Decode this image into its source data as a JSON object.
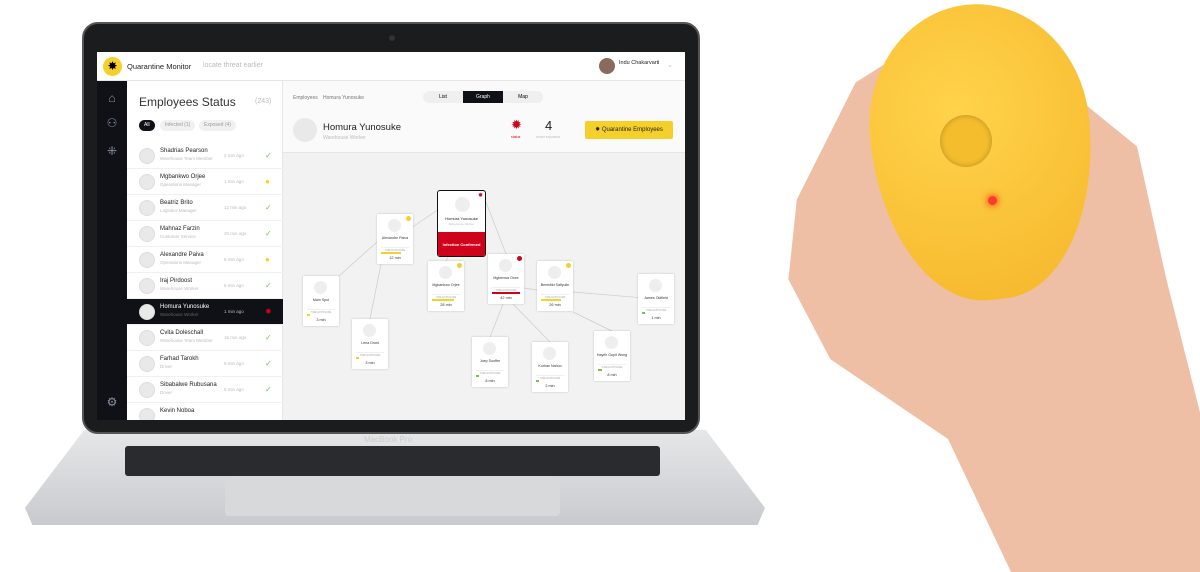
{
  "app": {
    "title": "Quarantine Monitor",
    "tagline": "locate threat earlier",
    "user": "Indu Chakarvarti"
  },
  "list": {
    "title": "Employees Status",
    "count": "(243)",
    "filters": [
      {
        "label": "All"
      },
      {
        "label": "Infected (1)"
      },
      {
        "label": "Exposed (4)"
      }
    ],
    "items": [
      {
        "name": "Shadrias Pearson",
        "role": "Warehouse Team Member",
        "time": "2 min ago",
        "status": "ok"
      },
      {
        "name": "Mgbankwo Orjee",
        "role": "Operations Manager",
        "time": "1 min ago",
        "status": "exposed"
      },
      {
        "name": "Beatriz Brito",
        "role": "Logistics Manager",
        "time": "12 min ago",
        "status": "ok"
      },
      {
        "name": "Mahnaz Farzin",
        "role": "Customer Service",
        "time": "20 min ago",
        "status": "ok"
      },
      {
        "name": "Alexandre Paiva",
        "role": "Operations Manager",
        "time": "6 min ago",
        "status": "exposed"
      },
      {
        "name": "Iraj Pirdoost",
        "role": "Warehouse Worker",
        "time": "6 min ago",
        "status": "ok"
      },
      {
        "name": "Homura Yunosuke",
        "role": "Warehouse Worker",
        "time": "1 min ago",
        "status": "infected"
      },
      {
        "name": "Cvita Doleschall",
        "role": "Warehouse Team Member",
        "time": "16 min ago",
        "status": "ok"
      },
      {
        "name": "Farhad Tarokh",
        "role": "Driver",
        "time": "9 min ago",
        "status": "ok"
      },
      {
        "name": "Sibabalwe Rubusana",
        "role": "Driver",
        "time": "8 min ago",
        "status": "ok"
      },
      {
        "name": "Kevin Noboa",
        "role": "",
        "time": "",
        "status": ""
      }
    ]
  },
  "main": {
    "breadcrumb": [
      "Employees",
      "Homura Yunosuke"
    ],
    "views": [
      "List",
      "Graph",
      "Map"
    ],
    "active_view": "Graph",
    "person": {
      "name": "Homura Yunosuke",
      "role": "Warehouse Worker",
      "status_label": "status",
      "exposure_count": "4",
      "exposure_label": "under exposure"
    },
    "quarantine_button": "Quarantine Employees",
    "infected_node": {
      "name": "Homura Yunosuke",
      "role": "Warehouse Worker",
      "label": "Infection Confirmed"
    },
    "exposure_label": "TIME EXPOSURE",
    "nodes": [
      {
        "name": "Alexandre Paiva",
        "time": "12 min",
        "level": 0.7,
        "color": "#f5d02a",
        "badge": true
      },
      {
        "name": "Main Sput",
        "time": "3 min",
        "level": 0.1,
        "color": "#f5d02a",
        "badge": false
      },
      {
        "name": "Lena Drust",
        "time": "3 min",
        "level": 0.1,
        "color": "#f5d02a",
        "badge": false
      },
      {
        "name": "Mgbankwo Orjee",
        "time": "28 min",
        "level": 0.8,
        "color": "#f5d02a",
        "badge": true
      },
      {
        "name": "Mgbenwa Ocee",
        "time": "42 min",
        "level": 1,
        "color": "#d0021b",
        "badge": true
      },
      {
        "name": "Benedikt Safiyulin",
        "time": "26 min",
        "level": 0.7,
        "color": "#f5d02a",
        "badge": true
      },
      {
        "name": "James Oldfield",
        "time": "1 min",
        "level": 0.1,
        "color": "#7cc04b",
        "badge": false
      },
      {
        "name": "Joep Souffer",
        "time": "8 min",
        "level": 0.1,
        "color": "#7cc04b",
        "badge": false
      },
      {
        "name": "Kurhan Nahuo",
        "time": "2 min",
        "level": 0.1,
        "color": "#7cc04b",
        "badge": false
      },
      {
        "name": "Hayrih Gupit Wong",
        "time": "8 min",
        "level": 0.15,
        "color": "#7cc04b",
        "badge": false
      }
    ]
  },
  "laptop": {
    "label": "MacBook Pro"
  },
  "colors": {
    "accent": "#f5d02a",
    "infected": "#d0021b",
    "ok": "#7cc04b",
    "device": "#f7c03a"
  }
}
